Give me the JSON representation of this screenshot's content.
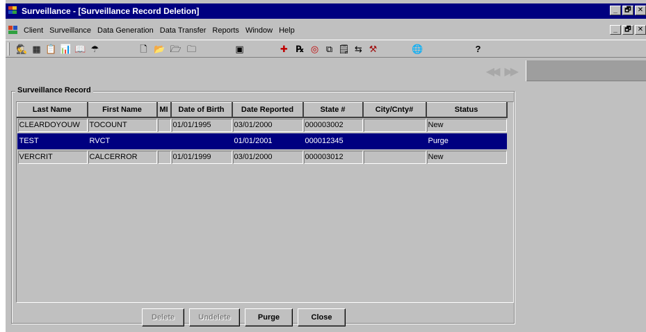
{
  "window": {
    "title": "Surveillance - [Surveillance Record Deletion]",
    "controls": [
      "_",
      "🗗",
      "✕"
    ]
  },
  "menu": {
    "items": [
      {
        "label": "Client",
        "mnemonic": "C"
      },
      {
        "label": "Surveillance",
        "mnemonic": "S"
      },
      {
        "label": "Data Generation",
        "mnemonic": "D"
      },
      {
        "label": "Data Transfer",
        "mnemonic": "T"
      },
      {
        "label": "Reports",
        "mnemonic": "R"
      },
      {
        "label": "Window",
        "mnemonic": "W"
      },
      {
        "label": "Help",
        "mnemonic": "H"
      }
    ]
  },
  "toolbar": {
    "buttons": [
      {
        "name": "find-client-icon",
        "glyph": "🕵"
      },
      {
        "name": "client-record-icon",
        "glyph": "▦"
      },
      {
        "name": "clipboard-icon",
        "glyph": "📋"
      },
      {
        "name": "bar-chart-icon",
        "glyph": "📊"
      },
      {
        "name": "book-icon",
        "glyph": "📖"
      },
      {
        "name": "umbrella-icon",
        "glyph": "☂"
      },
      {
        "name": "new-document-icon",
        "glyph": "🗋"
      },
      {
        "name": "open-folder-icon",
        "glyph": "📂"
      },
      {
        "name": "open-folder-alt-icon",
        "glyph": "🗁"
      },
      {
        "name": "folder-icon",
        "glyph": "🗀"
      },
      {
        "name": "grid-report-icon",
        "glyph": "▣"
      },
      {
        "name": "rvct-icon",
        "glyph": "✚"
      },
      {
        "name": "prescription-icon",
        "glyph": "℞"
      },
      {
        "name": "target-icon",
        "glyph": "◎"
      },
      {
        "name": "copy-icon",
        "glyph": "⧉"
      },
      {
        "name": "notebook-icon",
        "glyph": "🗒"
      },
      {
        "name": "transfer-icon",
        "glyph": "⇆"
      },
      {
        "name": "tools-icon",
        "glyph": "⚒"
      },
      {
        "name": "globe-icon",
        "glyph": "🌐"
      },
      {
        "name": "help-icon",
        "glyph": "?"
      }
    ]
  },
  "nav": {
    "prev": "◀◀",
    "next": "▶▶"
  },
  "form": {
    "group_title": "Surveillance Record",
    "columns": [
      "Last Name",
      "First Name",
      "MI",
      "Date of Birth",
      "Date Reported",
      "State #",
      "City/Cnty#",
      "Status"
    ],
    "rows": [
      {
        "last_name": "CLEARDOYOUW",
        "first_name": "TOCOUNT",
        "mi": "",
        "dob": "01/01/1995",
        "reported": "03/01/2000",
        "state": "000003002",
        "city": "",
        "status": "New",
        "selected": false
      },
      {
        "last_name": "TEST",
        "first_name": "RVCT",
        "mi": "",
        "dob": "",
        "reported": "01/01/2001",
        "state": "000012345",
        "city": "",
        "status": "Purge",
        "selected": true
      },
      {
        "last_name": "VERCRIT",
        "first_name": "CALCERROR",
        "mi": "",
        "dob": "01/01/1999",
        "reported": "03/01/2000",
        "state": "000003012",
        "city": "",
        "status": "New",
        "selected": false
      }
    ]
  },
  "buttons": {
    "delete": {
      "label": "Delete",
      "enabled": false
    },
    "undelete": {
      "label": "Undelete",
      "enabled": false
    },
    "purge": {
      "label": "Purge",
      "enabled": true
    },
    "close": {
      "label": "Close",
      "enabled": true
    }
  },
  "colors": {
    "title_bar": "#000080",
    "selection": "#000080",
    "face": "#c0c0c0"
  }
}
